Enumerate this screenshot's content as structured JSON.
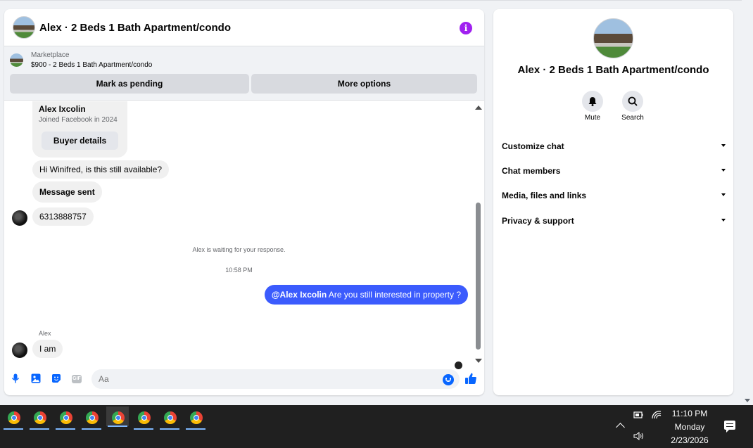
{
  "chat": {
    "title": "Alex · 2 Beds 1 Bath Apartment/condo",
    "listing": {
      "label": "Marketplace",
      "title": "$900 - 2 Beds 1 Bath Apartment/condo",
      "pending_button": "Mark as pending",
      "more_button": "More options"
    },
    "buyer": {
      "name": "Alex Ixcolin",
      "joined": "Joined Facebook in 2024",
      "details_button": "Buyer details"
    },
    "messages": {
      "m1": "Hi Winifred, is this still available?",
      "m2": "Message sent",
      "m3": "6313888757",
      "waiting": "Alex is waiting for your response.",
      "time": "10:58 PM",
      "out_mention": "@Alex Ixcolin",
      "out_text": " Are you still interested in property ?",
      "sender": "Alex",
      "m4": "I am"
    },
    "composer": {
      "placeholder": "Aa",
      "gif_label": "GIF"
    }
  },
  "info": {
    "title": "Alex · 2 Beds 1 Bath Apartment/condo",
    "mute_label": "Mute",
    "search_label": "Search",
    "sections": [
      "Customize chat",
      "Chat members",
      "Media, files and links",
      "Privacy & support"
    ]
  },
  "taskbar": {
    "time": "11:10 PM",
    "day": "Monday",
    "date": "2/23/2026"
  },
  "colors": {
    "accent": "#0866ff",
    "outgoing_bubble": "#3b5bfd",
    "info_icon": "#a020f0"
  },
  "icons": [
    "info-icon",
    "bell-icon",
    "search-icon",
    "microphone-icon",
    "photo-icon",
    "sticker-icon",
    "gif-icon",
    "emoji-icon",
    "thumbs-up-icon",
    "chrome-icon",
    "battery-icon",
    "wifi-icon",
    "volume-icon",
    "notification-icon"
  ]
}
